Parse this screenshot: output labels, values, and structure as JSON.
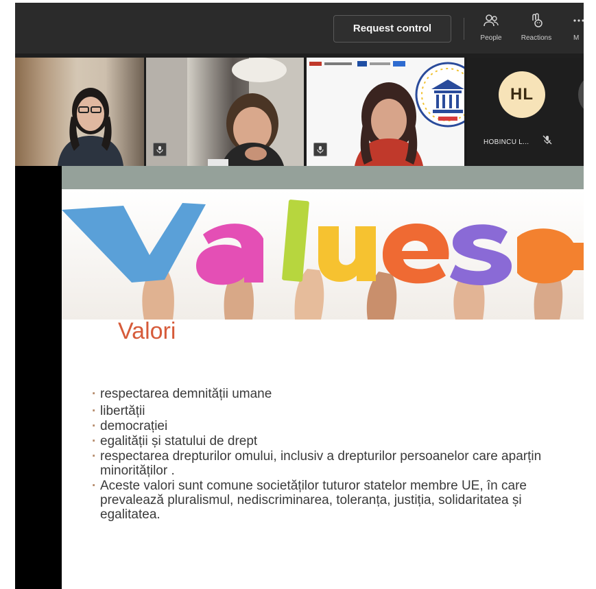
{
  "toolbar": {
    "request_control_label": "Request control",
    "people_label": "People",
    "reactions_label": "Reactions",
    "more_label": "M"
  },
  "video": {
    "participant_avatar_initials": "HL",
    "participant_name": "HOBINCU L..."
  },
  "slide": {
    "title": "Valori",
    "bullets": [
      "respectarea demnității umane",
      "libertății",
      " democrației",
      "egalității și statului de drept",
      "respectarea drepturilor omului, inclusiv a drepturilor persoanelor care aparțin minorităților .",
      "Aceste valori sunt comune societăților tuturor statelor membre UE, în care prevalează pluralismul, nediscriminarea, toleranța, justiția, solidaritatea și egalitatea."
    ],
    "values_image_letters": [
      "V",
      "a",
      "l",
      "u",
      "e",
      "s"
    ]
  },
  "colors": {
    "toolbar_bg": "#2b2b2b",
    "title_accent": "#d65b3a",
    "avatar_bg": "#f7e3b8",
    "slide_header_bar": "#95a19a"
  },
  "icons": {
    "people": "people-icon",
    "reactions": "reactions-icon",
    "more": "more-icon",
    "mic": "mic-icon",
    "muted": "mic-off-icon"
  }
}
